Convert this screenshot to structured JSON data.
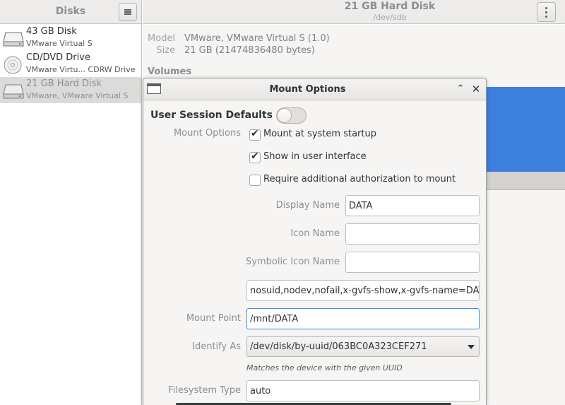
{
  "sidebar": {
    "title": "Disks",
    "drives": [
      {
        "name": "43 GB Disk",
        "sub": "VMware Virtual S",
        "icon": "hard-disk-icon",
        "selected": false
      },
      {
        "name": "CD/DVD Drive",
        "sub": "VMware Virtu... CDRW Drive",
        "icon": "optical-drive-icon",
        "selected": false
      },
      {
        "name": "21 GB Hard Disk",
        "sub": "VMware, VMware Virtual S",
        "icon": "hard-disk-icon",
        "selected": true
      }
    ]
  },
  "main": {
    "title": "21 GB Hard Disk",
    "subtitle": "/dev/sdb",
    "model_label": "Model",
    "model_value": "VMware, VMware Virtual S (1.0)",
    "size_label": "Size",
    "size_value": "21 GB (21474836480 bytes)",
    "volumes_heading": "Volumes",
    "volume_color": "#3d7fdc"
  },
  "dialog": {
    "title": "Mount Options",
    "user_session_defaults_label": "User Session Defaults",
    "user_session_defaults_on": false,
    "mount_options_label": "Mount Options",
    "checkboxes": [
      {
        "label": "Mount at system startup",
        "checked": true
      },
      {
        "label": "Show in user interface",
        "checked": true
      },
      {
        "label": "Require additional authorization to mount",
        "checked": false
      }
    ],
    "display_name_label": "Display Name",
    "display_name_value": "DATA",
    "icon_name_label": "Icon Name",
    "icon_name_value": "",
    "symbolic_icon_name_label": "Symbolic Icon Name",
    "symbolic_icon_name_value": "",
    "options_value": "nosuid,nodev,nofail,x-gvfs-show,x-gvfs-name=DATA",
    "mount_point_label": "Mount Point",
    "mount_point_value": "/mnt/DATA",
    "identify_as_label": "Identify As",
    "identify_as_value": "/dev/disk/by-uuid/063BC0A323CEF271",
    "identify_hint": "Matches the device with the given UUID",
    "fs_type_label": "Filesystem Type",
    "fs_type_value": "auto"
  },
  "colors": {
    "accent": "#3d8ae0",
    "check": "#2e3436"
  }
}
